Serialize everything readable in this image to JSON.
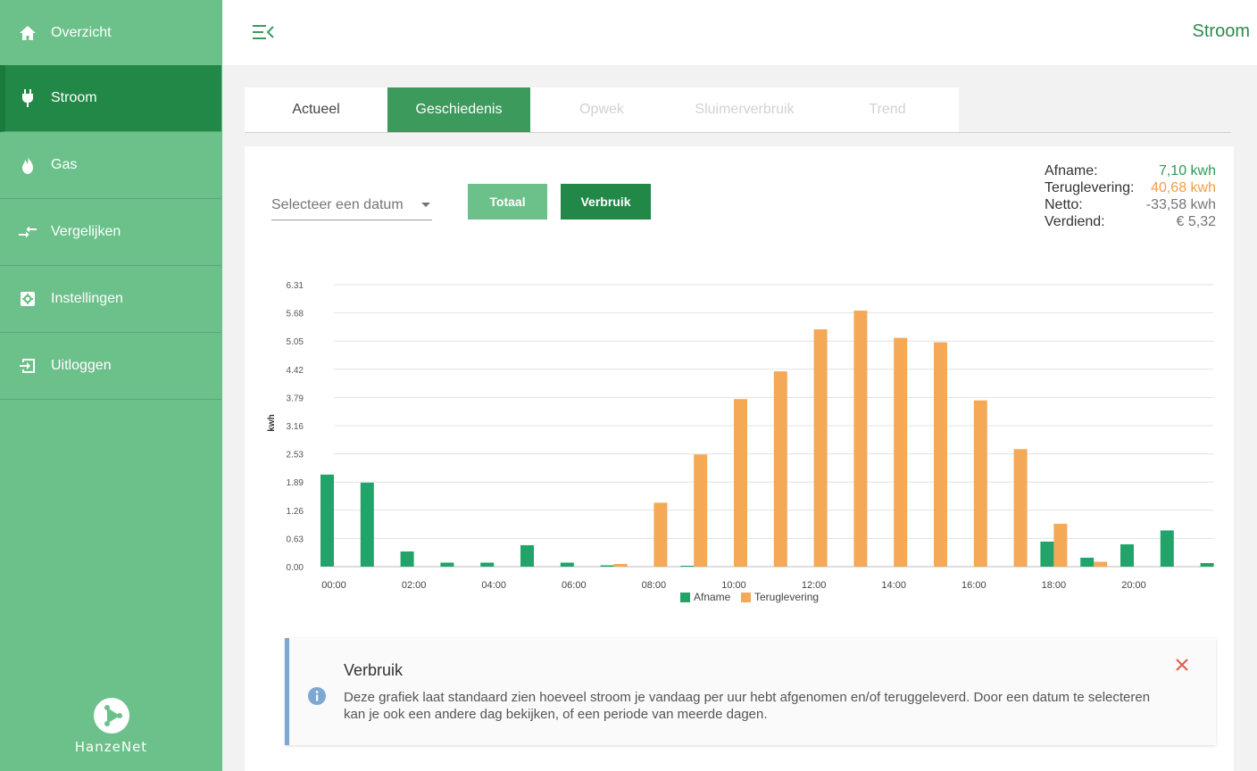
{
  "sidebar": {
    "items": [
      {
        "label": "Overzicht",
        "icon": "home-icon"
      },
      {
        "label": "Stroom",
        "icon": "plug-icon",
        "active": true
      },
      {
        "label": "Gas",
        "icon": "flame-icon"
      },
      {
        "label": "Vergelijken",
        "icon": "compare-arrows-icon"
      },
      {
        "label": "Instellingen",
        "icon": "settings-icon"
      },
      {
        "label": "Uitloggen",
        "icon": "logout-icon"
      }
    ],
    "logo_text": "HanzeNet"
  },
  "header": {
    "title": "Stroom"
  },
  "tabs": [
    {
      "label": "Actueel"
    },
    {
      "label": "Geschiedenis",
      "active": true
    },
    {
      "label": "Opwek"
    },
    {
      "label": "Sluimerverbruik"
    },
    {
      "label": "Trend"
    }
  ],
  "controls": {
    "date_placeholder": "Selecteer een datum",
    "totaal_label": "Totaal",
    "verbruik_label": "Verbruik"
  },
  "summary": {
    "afname_label": "Afname:",
    "afname_value": "7,10 kwh",
    "teruglevering_label": "Teruglevering:",
    "teruglevering_value": "40,68 kwh",
    "netto_label": "Netto:",
    "netto_value": "-33,58 kwh",
    "verdiend_label": "Verdiend:",
    "verdiend_value": "€ 5,32"
  },
  "colors": {
    "sidebar": "#6cc08a",
    "active": "#228847",
    "afname": "#22a36a",
    "teruglevering": "#f5a855"
  },
  "chart_data": {
    "type": "bar",
    "ylabel": "kwh",
    "ylim": [
      0,
      6.31
    ],
    "yticks": [
      "6.31",
      "5.68",
      "5.05",
      "4.42",
      "3.79",
      "3.16",
      "2.53",
      "1.89",
      "1.26",
      "0.63",
      "0.00"
    ],
    "xtick_labels": [
      "00:00",
      "02:00",
      "04:00",
      "06:00",
      "08:00",
      "10:00",
      "12:00",
      "14:00",
      "16:00",
      "18:00",
      "20:00"
    ],
    "categories": [
      "00:00",
      "01:00",
      "02:00",
      "03:00",
      "04:00",
      "05:00",
      "06:00",
      "07:00",
      "08:00",
      "09:00",
      "10:00",
      "11:00",
      "12:00",
      "13:00",
      "14:00",
      "15:00",
      "16:00",
      "17:00",
      "18:00",
      "19:00",
      "20:00",
      "21:00",
      "22:00"
    ],
    "series": [
      {
        "name": "Afname",
        "color": "#22a36a",
        "values": [
          2.06,
          1.88,
          0.34,
          0.09,
          0.09,
          0.48,
          0.09,
          0.03,
          0,
          0.02,
          0,
          0,
          0,
          0,
          0,
          0,
          0,
          0,
          0.56,
          0.2,
          0.5,
          0.81,
          0.08
        ]
      },
      {
        "name": "Teruglevering",
        "color": "#f5a855",
        "values": [
          0,
          0,
          0,
          0,
          0,
          0,
          0,
          0.06,
          1.43,
          2.51,
          3.75,
          4.37,
          5.31,
          5.73,
          5.12,
          5.02,
          3.72,
          2.63,
          0.96,
          0.11,
          0,
          0,
          0
        ]
      }
    ],
    "legend": "bottom-center"
  },
  "info": {
    "title": "Verbruik",
    "text": "Deze grafiek laat standaard zien hoeveel stroom je vandaag per uur hebt afgenomen en/of teruggeleverd. Door een datum te selecteren kan je ook een andere dag bekijken, of een periode van meerde dagen."
  }
}
